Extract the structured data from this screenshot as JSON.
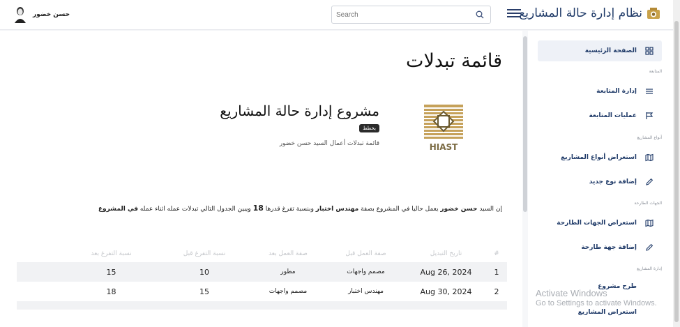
{
  "header": {
    "app_title": "نظام إدارة حالة المشاريع",
    "search_placeholder": "Search",
    "user_name": "حسن خضور"
  },
  "main": {
    "page_title": "قائمة تبدلات",
    "project": {
      "title": "مشروع إدارة حالة المشاريع",
      "badge": "يخطط",
      "subtitle": "قائمة تبدلات أعمال السيد حسن خضور",
      "logo_text": "HIAST"
    },
    "intro": {
      "p1": "إن السيد ",
      "name": "حسن خضور",
      "p2": " يعمل حاليا في المشروع بصفة ",
      "role": "مهندس اختبار",
      "p3": " وبنسبة تفرغ قدرها ",
      "pct": "18",
      "p4": " ويبين الجدول التالي تبدلات عمله اثناء عمله ",
      "tail": "في المشروع"
    },
    "table": {
      "headers": [
        "#",
        "تاريخ التبديل",
        "صفة العمل قبل",
        "صفة العمل بعد",
        "نسبة التفرغ قبل",
        "نسبة التفرغ بعد"
      ],
      "rows": [
        [
          "1",
          "Aug 26, 2024",
          "مصمم واجهات",
          "مطور",
          "10",
          "15"
        ],
        [
          "2",
          "Aug 30, 2024",
          "مهندس اختبار",
          "مصمم واجهات",
          "15",
          "18"
        ]
      ]
    }
  },
  "sidebar": {
    "home": "الصفحة الرئيسية",
    "section_follow": "المتابعة",
    "follow_manage": "إدارة المتابعة",
    "follow_ops": "عمليات المتابعة",
    "section_types": "أنواع المشاريع",
    "types_browse": "استعراض أنواع المشاريع",
    "types_add": "إضافة نوع جديد",
    "section_parties": "الجهات الطارحة",
    "parties_browse": "استعراض الجهات الطارحة",
    "parties_add": "إضافة جهة طارحة",
    "section_projects": "إدارة المشاريع",
    "projects_propose": "طرح مشروع",
    "projects_browse": "استعراض المشاريع"
  },
  "watermark": {
    "line1": "Activate Windows",
    "line2": "Go to Settings to activate Windows."
  },
  "colors": {
    "brand": "#1f3a68",
    "accent_active": "#eef1f7"
  }
}
